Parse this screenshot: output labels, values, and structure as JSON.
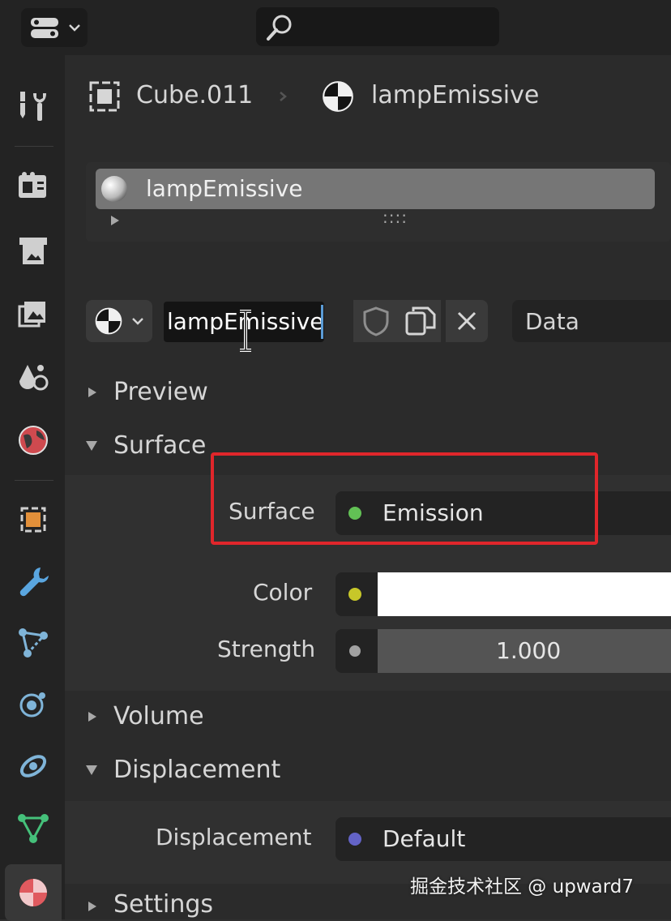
{
  "breadcrumb": {
    "object": "Cube.011",
    "material": "lampEmissive"
  },
  "slot_list": {
    "items": [
      "lampEmissive"
    ],
    "grip": "::::"
  },
  "material_selector": {
    "name_value": "lampEmissive",
    "link_value": "Data"
  },
  "panels": {
    "preview": {
      "label": "Preview",
      "expanded": false
    },
    "surface": {
      "label": "Surface",
      "expanded": true,
      "properties": [
        {
          "label": "Surface",
          "value": "Emission",
          "socket_color": "#62c155"
        },
        {
          "label": "Color",
          "value": "",
          "socket_color": "#c7c729",
          "swatch": "#ffffff"
        },
        {
          "label": "Strength",
          "value": "1.000",
          "socket_color": "#a1a1a1"
        }
      ]
    },
    "volume": {
      "label": "Volume",
      "expanded": false
    },
    "displacement": {
      "label": "Displacement",
      "expanded": true,
      "properties": [
        {
          "label": "Displacement",
          "value": "Default",
          "socket_color": "#6363c7"
        }
      ]
    },
    "settings": {
      "label": "Settings",
      "expanded": false
    }
  },
  "watermark": "掘金技术社区 @ upward7",
  "colors": {
    "highlight_box": "#e0262b",
    "active_tab_icon": "#e05a5f"
  }
}
